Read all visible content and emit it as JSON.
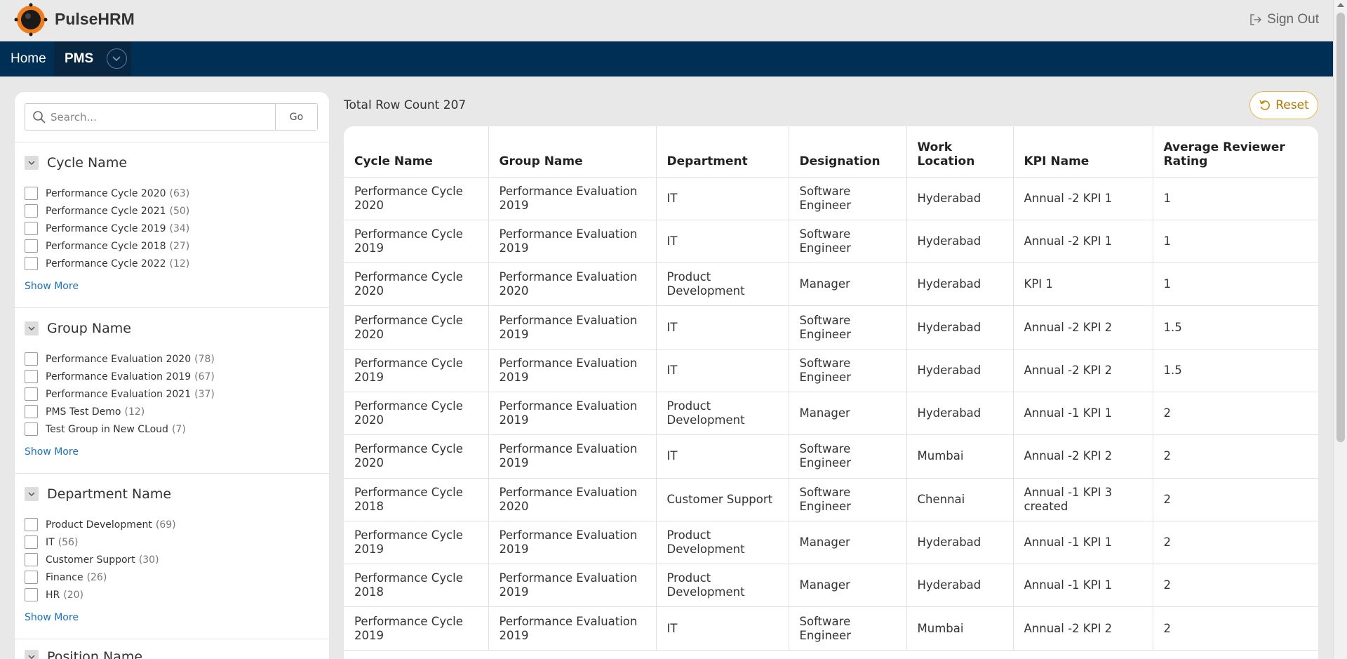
{
  "app": {
    "brand": "PulseHRM",
    "sign_out": "Sign Out"
  },
  "nav": {
    "home": "Home",
    "pms": "PMS"
  },
  "search": {
    "placeholder": "Search...",
    "go": "Go"
  },
  "facets": [
    {
      "title": "Cycle Name",
      "items": [
        {
          "label": "Performance Cycle 2020",
          "count": "(63)"
        },
        {
          "label": "Performance Cycle 2021",
          "count": "(50)"
        },
        {
          "label": "Performance Cycle 2019",
          "count": "(34)"
        },
        {
          "label": "Performance Cycle 2018",
          "count": "(27)"
        },
        {
          "label": "Performance Cycle 2022",
          "count": "(12)"
        }
      ],
      "show_more": "Show More"
    },
    {
      "title": "Group Name",
      "items": [
        {
          "label": "Performance Evaluation 2020",
          "count": "(78)"
        },
        {
          "label": "Performance Evaluation 2019",
          "count": "(67)"
        },
        {
          "label": "Performance Evaluation 2021",
          "count": "(37)"
        },
        {
          "label": "PMS Test Demo",
          "count": "(12)"
        },
        {
          "label": "Test Group in New CLoud",
          "count": "(7)"
        }
      ],
      "show_more": "Show More"
    },
    {
      "title": "Department Name",
      "items": [
        {
          "label": "Product Development",
          "count": "(69)"
        },
        {
          "label": "IT",
          "count": "(56)"
        },
        {
          "label": "Customer Support",
          "count": "(30)"
        },
        {
          "label": "Finance",
          "count": "(26)"
        },
        {
          "label": "HR",
          "count": "(20)"
        }
      ],
      "show_more": "Show More"
    },
    {
      "title": "Position Name",
      "items": [],
      "show_more": ""
    }
  ],
  "main": {
    "row_count": "Total Row Count 207",
    "reset": "Reset"
  },
  "table": {
    "headers": [
      "Cycle Name",
      "Group Name",
      "Department",
      "Designation",
      "Work Location",
      "KPI Name",
      "Average Reviewer Rating"
    ],
    "rows": [
      [
        "Performance Cycle 2020",
        "Performance Evaluation 2019",
        "IT",
        "Software Engineer",
        "Hyderabad",
        "Annual -2 KPI 1",
        "1"
      ],
      [
        "Performance Cycle 2019",
        "Performance Evaluation 2019",
        "IT",
        "Software Engineer",
        "Hyderabad",
        "Annual -2 KPI 1",
        "1"
      ],
      [
        "Performance Cycle 2020",
        "Performance Evaluation 2020",
        "Product Development",
        "Manager",
        "Hyderabad",
        "KPI 1",
        "1"
      ],
      [
        "Performance Cycle 2020",
        "Performance Evaluation 2019",
        "IT",
        "Software Engineer",
        "Hyderabad",
        "Annual -2 KPI 2",
        "1.5"
      ],
      [
        "Performance Cycle 2019",
        "Performance Evaluation 2019",
        "IT",
        "Software Engineer",
        "Hyderabad",
        "Annual -2 KPI 2",
        "1.5"
      ],
      [
        "Performance Cycle 2020",
        "Performance Evaluation 2019",
        "Product Development",
        "Manager",
        "Hyderabad",
        "Annual -1 KPI 1",
        "2"
      ],
      [
        "Performance Cycle 2020",
        "Performance Evaluation 2019",
        "IT",
        "Software Engineer",
        "Mumbai",
        "Annual -2 KPI 2",
        "2"
      ],
      [
        "Performance Cycle 2018",
        "Performance Evaluation 2020",
        "Customer Support",
        "Software Engineer",
        "Chennai",
        "Annual -1 KPI 3 created",
        "2"
      ],
      [
        "Performance Cycle 2019",
        "Performance Evaluation 2019",
        "Product Development",
        "Manager",
        "Hyderabad",
        "Annual -1 KPI 1",
        "2"
      ],
      [
        "Performance Cycle 2018",
        "Performance Evaluation 2019",
        "Product Development",
        "Manager",
        "Hyderabad",
        "Annual -1 KPI 1",
        "2"
      ],
      [
        "Performance Cycle 2019",
        "Performance Evaluation 2019",
        "IT",
        "Software Engineer",
        "Mumbai",
        "Annual -2 KPI 2",
        "2"
      ]
    ]
  },
  "colors": {
    "nav_bg": "#002f55",
    "nav_active_bg": "#092640",
    "link": "#1a73c6",
    "reset_border": "#e8b84c",
    "logo_orange": "#f07d1a"
  },
  "icons": {
    "logo": "pulse-logo-icon",
    "sign_out": "sign-out-icon",
    "search": "search-icon",
    "collapse": "chevron-down-icon",
    "reset": "reset-icon"
  }
}
